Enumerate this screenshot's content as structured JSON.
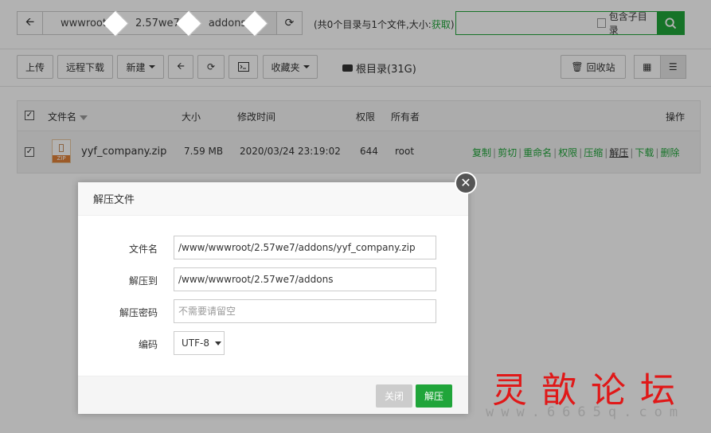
{
  "pathbar": {
    "back_icon": "arrow-left-icon",
    "crumbs": [
      "wwwroot",
      "2.57we7",
      "addons"
    ],
    "refresh_icon": "refresh-icon"
  },
  "count": {
    "prefix": "(共0个目录与1个文件,大小:",
    "link": "获取",
    "suffix": ")"
  },
  "search": {
    "placeholder": "",
    "include_sub_label": "包含子目录",
    "button_icon": "search-icon"
  },
  "toolbar": {
    "upload": "上传",
    "remote_download": "远程下载",
    "new": "新建",
    "back_icon": "arrow-left-icon",
    "refresh_icon": "refresh-icon",
    "terminal_icon": "terminal-icon",
    "favorites": "收藏夹",
    "root_dir": "根目录(31G)",
    "recycle": "回收站"
  },
  "table": {
    "headers": {
      "name": "文件名",
      "size": "大小",
      "mtime": "修改时间",
      "perm": "权限",
      "owner": "所有者",
      "ops": "操作"
    },
    "rows": [
      {
        "name": "yyf_company.zip",
        "size": "7.59 MB",
        "mtime": "2020/03/24 23:19:02",
        "perm": "644",
        "owner": "root",
        "icon_tag": "ZIP",
        "ops": [
          "复制",
          "剪切",
          "重命名",
          "权限",
          "压缩",
          "解压",
          "下载",
          "删除"
        ]
      }
    ]
  },
  "modal": {
    "title": "解压文件",
    "fields": {
      "filename_label": "文件名",
      "filename_value": "/www/wwwroot/2.57we7/addons/yyf_company.zip",
      "target_label": "解压到",
      "target_value": "/www/wwwroot/2.57we7/addons",
      "password_label": "解压密码",
      "password_placeholder": "不需要请留空",
      "encoding_label": "编码",
      "encoding_value": "UTF-8"
    },
    "close_button": "关闭",
    "confirm_button": "解压"
  },
  "watermark": {
    "title": "灵歆论坛",
    "url": "www.6665q.com"
  },
  "colors": {
    "accent": "#20a53a",
    "watermark_red": "#e01818"
  }
}
